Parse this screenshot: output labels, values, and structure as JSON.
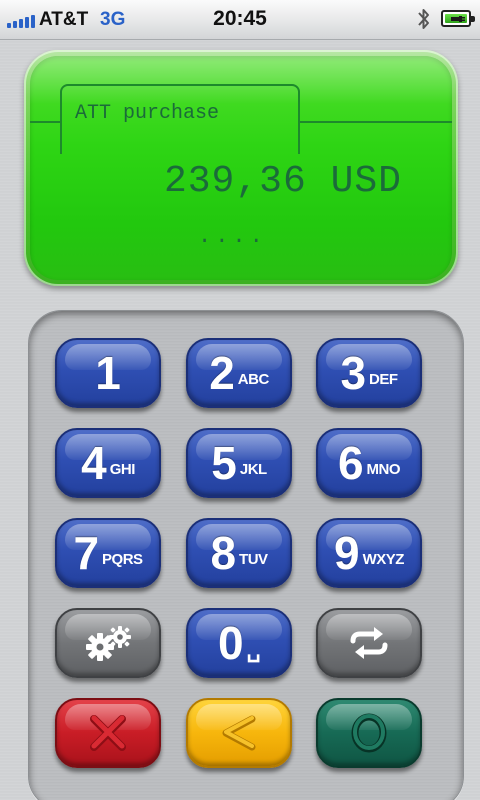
{
  "status_bar": {
    "carrier": "AT&T",
    "network": "3G",
    "time": "20:45",
    "signal_bars": 5,
    "bluetooth_icon": "bluetooth-icon",
    "battery_icon": "battery-charging-icon"
  },
  "display": {
    "title": "ATT purchase",
    "amount": "239,36 USD",
    "pin_mask": "....",
    "color": "#2ed514",
    "text_color": "#1b6b3a"
  },
  "keypad": {
    "keys": [
      {
        "digit": "1",
        "letters": ""
      },
      {
        "digit": "2",
        "letters": "ABC"
      },
      {
        "digit": "3",
        "letters": "DEF"
      },
      {
        "digit": "4",
        "letters": "GHI"
      },
      {
        "digit": "5",
        "letters": "JKL"
      },
      {
        "digit": "6",
        "letters": "MNO"
      },
      {
        "digit": "7",
        "letters": "PQRS"
      },
      {
        "digit": "8",
        "letters": "TUV"
      },
      {
        "digit": "9",
        "letters": "WXYZ"
      },
      {
        "digit": "0",
        "letters": "␣"
      }
    ],
    "function_keys": {
      "settings_icon": "gears-icon",
      "switch_icon": "swap-arrows-icon",
      "cancel_icon": "x-icon",
      "back_icon": "less-than-icon",
      "ok_icon": "circle-icon"
    },
    "colors": {
      "digit_keys": "#2f4fb3",
      "function_keys": "#737578",
      "cancel": "#c91d26",
      "back": "#f7b60c",
      "ok": "#176a55"
    }
  }
}
